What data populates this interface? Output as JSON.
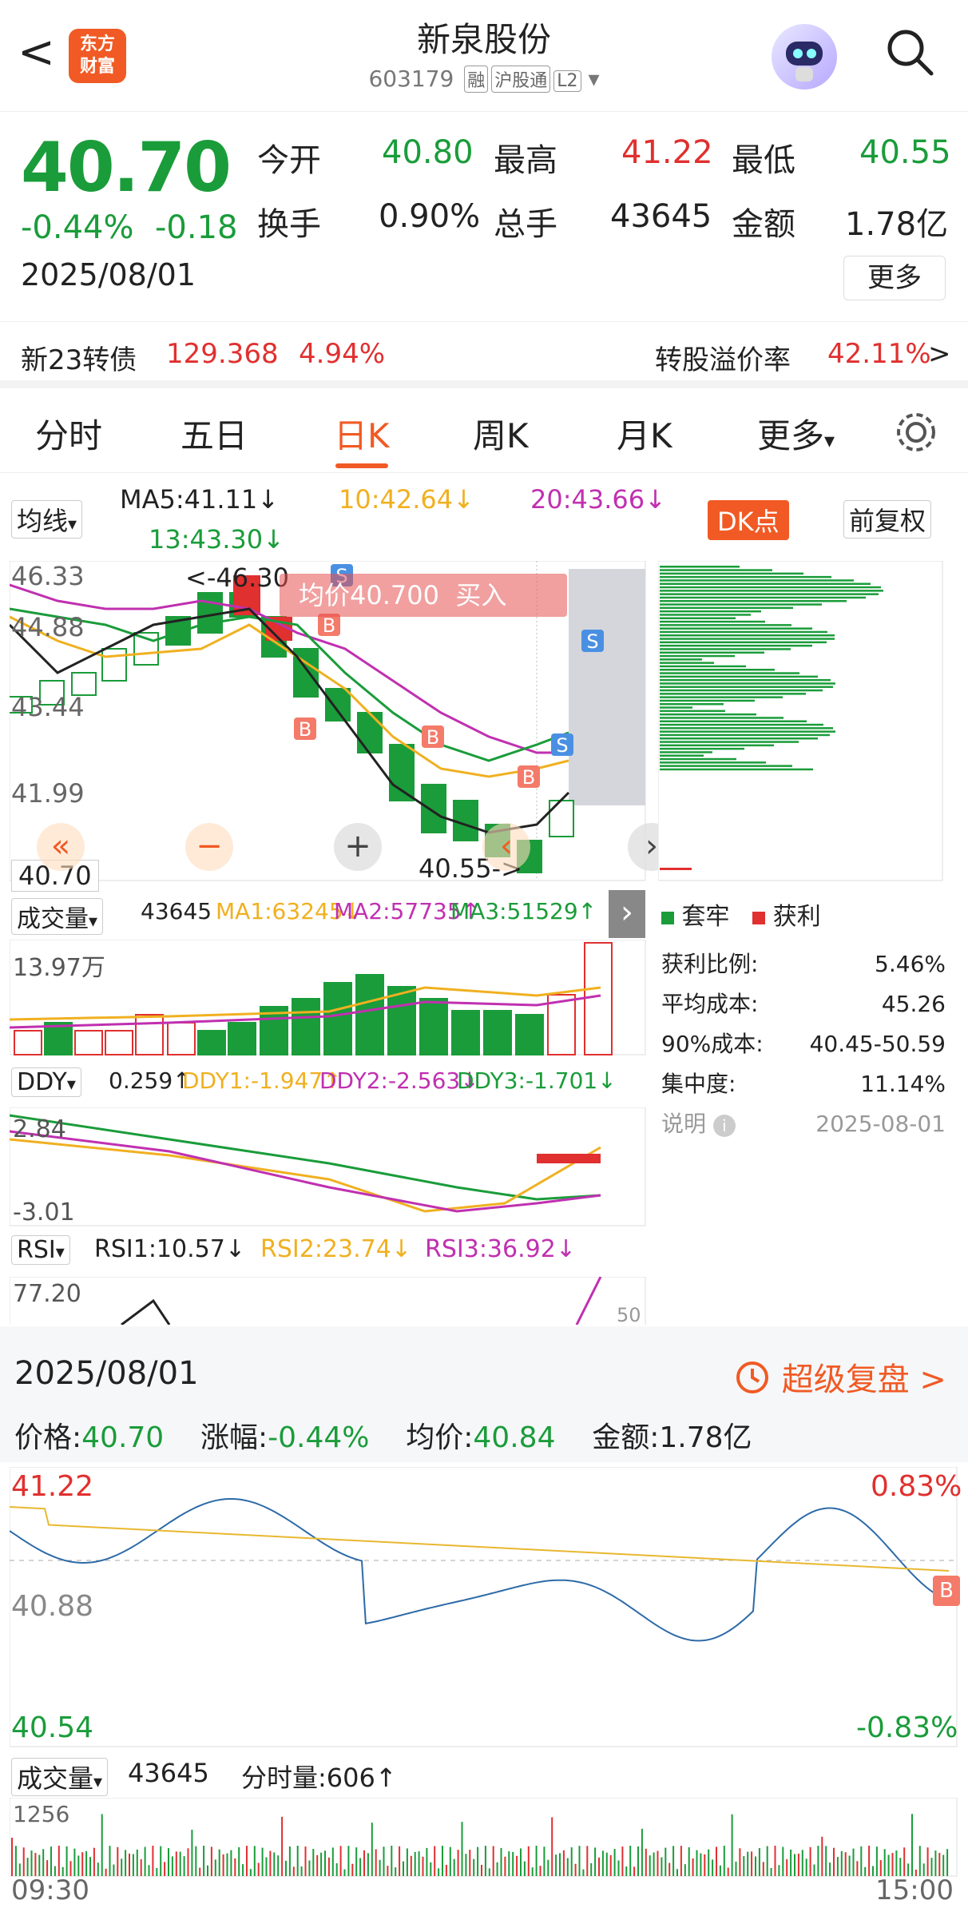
{
  "header": {
    "back": "<",
    "logo_line1": "东方",
    "logo_line2": "财富",
    "title": "新泉股份",
    "code": "603179",
    "tags": [
      "融",
      "沪股通",
      "L2"
    ],
    "dropdown": "▾"
  },
  "quote": {
    "price": "40.70",
    "pct": "-0.44%",
    "chg": "-0.18",
    "date": "2025/08/01",
    "open_label": "今开",
    "open": "40.80",
    "high_label": "最高",
    "high": "41.22",
    "low_label": "最低",
    "low": "40.55",
    "turnover_label": "换手",
    "turnover": "0.90%",
    "volume_label": "总手",
    "volume": "43645",
    "amount_label": "金额",
    "amount": "1.78亿",
    "more": "更多"
  },
  "bond": {
    "name": "新23转债",
    "price": "129.368",
    "pct": "4.94%",
    "premium_label": "转股溢价率",
    "premium": "42.11%",
    "arrow": ">"
  },
  "tabs": [
    "分时",
    "五日",
    "日K",
    "周K",
    "月K",
    "更多"
  ],
  "tabs_active": "日K",
  "more_caret": "▾",
  "kline": {
    "ma_label": "均线",
    "ma5": "MA5:41.11↓",
    "ma10": "10:42.64↓",
    "ma20": "20:43.66↓",
    "ma13": "13:43.30↓",
    "dk_label": "DK点",
    "fq_label": "前复权",
    "y_ticks": [
      "46.33",
      "44.88",
      "43.44",
      "41.99",
      "40.70"
    ],
    "high_marker": "<-46.30",
    "low_marker": "40.55->",
    "avg_banner": "均价40.700",
    "buy": "买入",
    "b_marks": [
      "B",
      "B",
      "B",
      "B"
    ],
    "s_marks": [
      "S",
      "S",
      "S"
    ],
    "ctl_left": "«",
    "ctl_minus": "−",
    "ctl_plus": "+",
    "ctl_prev": "‹",
    "ctl_next": "›"
  },
  "chip": {
    "legend_trap": "套牢",
    "legend_profit": "获利",
    "rows": [
      {
        "k": "获利比例:",
        "v": "5.46%"
      },
      {
        "k": "平均成本:",
        "v": "45.26"
      },
      {
        "k": "90%成本:",
        "v": "40.45-50.59"
      },
      {
        "k": "集中度:",
        "v": "11.14%"
      }
    ],
    "note_label": "说明",
    "note_date": "2025-08-01"
  },
  "volume": {
    "label": "成交量",
    "value": "43645",
    "ma1": "MA1:63245↓",
    "ma2": "MA2:57735↑",
    "ma3": "MA3:51529↑",
    "max": "13.97万",
    "expand": "›"
  },
  "ddy": {
    "label": "DDY",
    "value": "0.259↑",
    "d1": "DDY1:-1.947↑",
    "d2": "DDY2:-2.563↓",
    "d3": "DDY3:-1.701↓",
    "top": "2.84",
    "bottom": "-3.01"
  },
  "rsi": {
    "label": "RSI",
    "r1": "RSI1:10.57↓",
    "r2": "RSI2:23.74↓",
    "r3": "RSI3:36.92↓",
    "top": "77.20",
    "mid": "50"
  },
  "intraday": {
    "date": "2025/08/01",
    "replay": "超级复盘 >",
    "price_label": "价格:",
    "price": "40.70",
    "pct_label": "涨幅:",
    "pct": "-0.44%",
    "avg_label": "均价:",
    "avg": "40.84",
    "amt_label": "金额:",
    "amt": "1.78亿",
    "y_top": "41.22",
    "y_mid": "40.88",
    "y_bot": "40.54",
    "pct_top": "0.83%",
    "pct_bot": "-0.83%",
    "b_mark": "B",
    "vol_label": "成交量",
    "vol": "43645",
    "fs_label": "分时量:",
    "fs": "606↑",
    "vol_max": "1256",
    "t_start": "09:30",
    "t_end": "15:00"
  },
  "colors": {
    "red": "#e0302f",
    "green": "#1a9c3a",
    "orange": "#f15a24",
    "ma5": "#222222",
    "ma10": "#f0b020",
    "ma20": "#c030b0",
    "ma13": "#1a9c3a",
    "line": "#2d6aa8",
    "avg": "#e8b830"
  }
}
